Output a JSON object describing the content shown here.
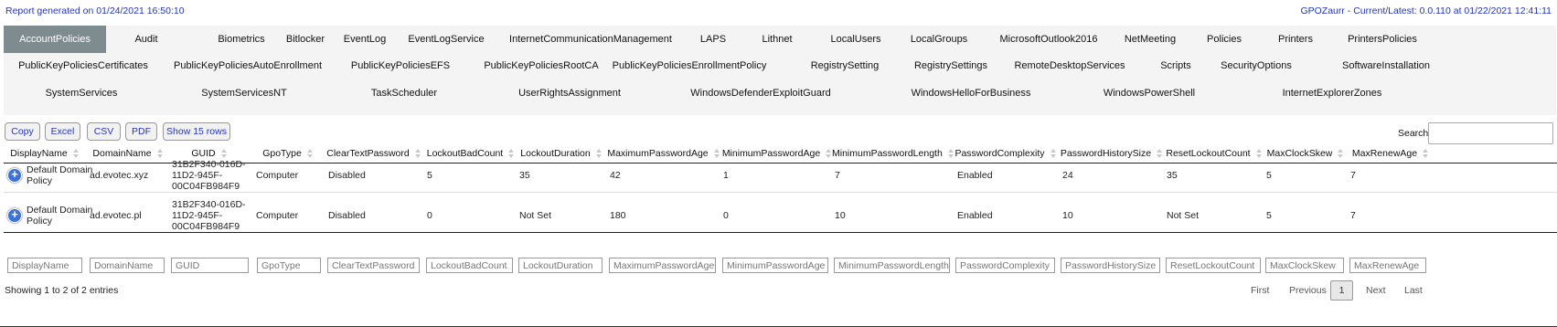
{
  "header": {
    "report_generated": "Report generated on 01/24/2021 16:50:10",
    "version": "GPOZaurr - Current/Latest: 0.0.110 at 01/22/2021 12:41:11"
  },
  "tabs": {
    "row1": [
      "AccountPolicies",
      "Audit",
      "Biometrics",
      "Bitlocker",
      "EventLog",
      "EventLogService",
      "InternetCommunicationManagement",
      "LAPS",
      "Lithnet",
      "LocalUsers",
      "LocalGroups",
      "MicrosoftOutlook2016",
      "NetMeeting",
      "Policies",
      "Printers",
      "PrintersPolicies"
    ],
    "row2": [
      "PublicKeyPoliciesCertificates",
      "PublicKeyPoliciesAutoEnrollment",
      "PublicKeyPoliciesEFS",
      "PublicKeyPoliciesRootCA",
      "PublicKeyPoliciesEnrollmentPolicy",
      "RegistrySetting",
      "RegistrySettings",
      "RemoteDesktopServices",
      "Scripts",
      "SecurityOptions",
      "SoftwareInstallation"
    ],
    "row3": [
      "SystemServices",
      "SystemServicesNT",
      "TaskScheduler",
      "UserRightsAssignment",
      "WindowsDefenderExploitGuard",
      "WindowsHelloForBusiness",
      "WindowsPowerShell",
      "InternetExplorerZones"
    ],
    "active": "AccountPolicies"
  },
  "toolbar": {
    "buttons": [
      "Copy",
      "Excel",
      "CSV",
      "PDF",
      "Show 15 rows"
    ],
    "search_label": "Search:",
    "search_value": ""
  },
  "table": {
    "columns": [
      "DisplayName",
      "DomainName",
      "GUID",
      "GpoType",
      "ClearTextPassword",
      "LockoutBadCount",
      "LockoutDuration",
      "MaximumPasswordAge",
      "MinimumPasswordAge",
      "MinimumPasswordLength",
      "PasswordComplexity",
      "PasswordHistorySize",
      "ResetLockoutCount",
      "MaxClockSkew",
      "MaxRenewAge"
    ],
    "rows": [
      [
        "Default Domain\nPolicy",
        "ad.evotec.xyz",
        "31B2F340-016D-\n11D2-945F-\n00C04FB984F9",
        "Computer",
        "Disabled",
        "5",
        "35",
        "42",
        "1",
        "7",
        "Enabled",
        "24",
        "35",
        "5",
        "7"
      ],
      [
        "Default Domain\nPolicy",
        "ad.evotec.pl",
        "31B2F340-016D-\n11D2-945F-\n00C04FB984F9",
        "Computer",
        "Disabled",
        "0",
        "Not Set",
        "180",
        "0",
        "10",
        "Enabled",
        "10",
        "Not Set",
        "5",
        "7"
      ]
    ],
    "filter_placeholders": [
      "DisplayName",
      "DomainName",
      "GUID",
      "GpoType",
      "ClearTextPassword",
      "LockoutBadCount",
      "LockoutDuration",
      "MaximumPasswordAge",
      "MinimumPasswordAge",
      "MinimumPasswordLength",
      "PasswordComplexity",
      "PasswordHistorySize",
      "ResetLockoutCount",
      "MaxClockSkew",
      "MaxRenewAge"
    ]
  },
  "footer": {
    "info": "Showing 1 to 2 of 2 entries",
    "first": "First",
    "previous": "Previous",
    "current_page": "1",
    "next": "Next",
    "last": "Last"
  },
  "colors": {
    "accent_blue": "#2233cc",
    "active_tab_bg": "#7f8c8f",
    "expand_button": "#3b73d8"
  }
}
